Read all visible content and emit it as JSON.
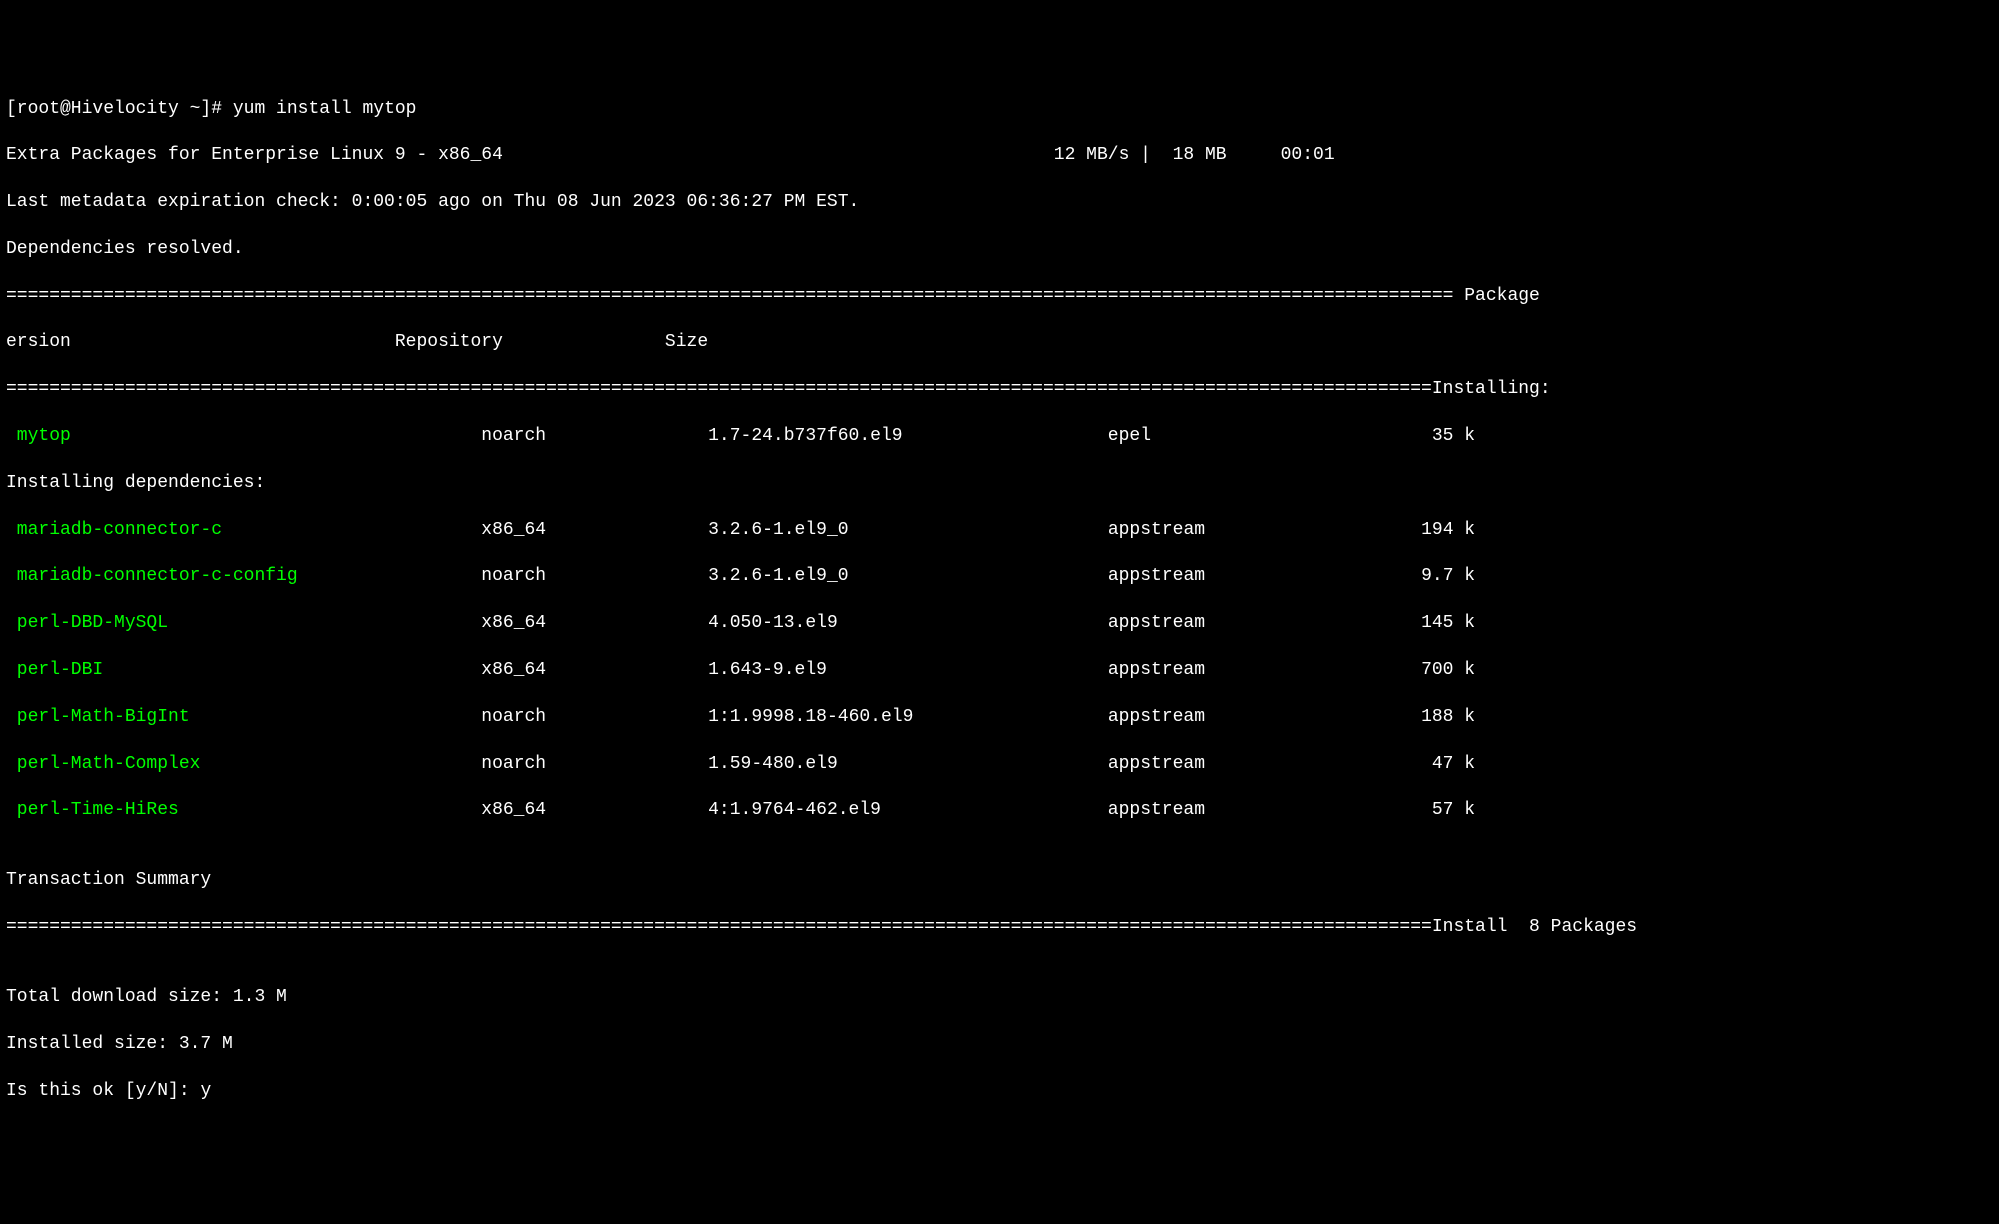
{
  "prompt": "[root@Hivelocity ~]# ",
  "command": "yum install mytop",
  "repo_line": "Extra Packages for Enterprise Linux 9 - x86_64                                                   12 MB/s |  18 MB     00:01",
  "metadata_line": "Last metadata expiration check: 0:00:05 ago on Thu 08 Jun 2023 06:36:27 PM EST.",
  "deps_resolved": "Dependencies resolved.",
  "divider1_left": "====================================================================================================================================== ",
  "divider1_right": "Package",
  "header_row": "ersion                              Repository               Size",
  "divider2_left": "====================================================================================================================================",
  "divider2_right": "Installing:",
  "installing_deps_label": "Installing dependencies:",
  "packages": {
    "main": {
      "name": " mytop",
      "pad_after_name": "                                      ",
      "arch": "noarch",
      "pad2": "               ",
      "version": "1.7-24.b737f60.el9",
      "pad3": "                   ",
      "repo": "epel",
      "pad4": "                          ",
      "size": "35 k"
    },
    "deps": [
      {
        "name": " mariadb-connector-c",
        "pad": "                        ",
        "arch": "x86_64",
        "pad2": "               ",
        "version": "3.2.6-1.el9_0",
        "pad3": "                        ",
        "repo": "appstream",
        "pad4": "                    ",
        "size": "194 k"
      },
      {
        "name": " mariadb-connector-c-config",
        "pad": "                 ",
        "arch": "noarch",
        "pad2": "               ",
        "version": "3.2.6-1.el9_0",
        "pad3": "                        ",
        "repo": "appstream",
        "pad4": "                    ",
        "size": "9.7 k"
      },
      {
        "name": " perl-DBD-MySQL",
        "pad": "                             ",
        "arch": "x86_64",
        "pad2": "               ",
        "version": "4.050-13.el9",
        "pad3": "                         ",
        "repo": "appstream",
        "pad4": "                    ",
        "size": "145 k"
      },
      {
        "name": " perl-DBI",
        "pad": "                                   ",
        "arch": "x86_64",
        "pad2": "               ",
        "version": "1.643-9.el9",
        "pad3": "                          ",
        "repo": "appstream",
        "pad4": "                    ",
        "size": "700 k"
      },
      {
        "name": " perl-Math-BigInt",
        "pad": "                           ",
        "arch": "noarch",
        "pad2": "               ",
        "version": "1:1.9998.18-460.el9",
        "pad3": "                  ",
        "repo": "appstream",
        "pad4": "                    ",
        "size": "188 k"
      },
      {
        "name": " perl-Math-Complex",
        "pad": "                          ",
        "arch": "noarch",
        "pad2": "               ",
        "version": "1.59-480.el9",
        "pad3": "                         ",
        "repo": "appstream",
        "pad4": "                     ",
        "size": "47 k"
      },
      {
        "name": " perl-Time-HiRes",
        "pad": "                            ",
        "arch": "x86_64",
        "pad2": "               ",
        "version": "4:1.9764-462.el9",
        "pad3": "                     ",
        "repo": "appstream",
        "pad4": "                     ",
        "size": "57 k"
      }
    ]
  },
  "blank": "",
  "summary_label": "Transaction Summary",
  "divider3_left": "====================================================================================================================================",
  "divider3_right": "Install  8 Packages",
  "total_download": "Total download size: 1.3 M",
  "installed_size": "Installed size: 3.7 M",
  "confirm_prompt": "Is this ok [y/N]: ",
  "confirm_answer": "y"
}
